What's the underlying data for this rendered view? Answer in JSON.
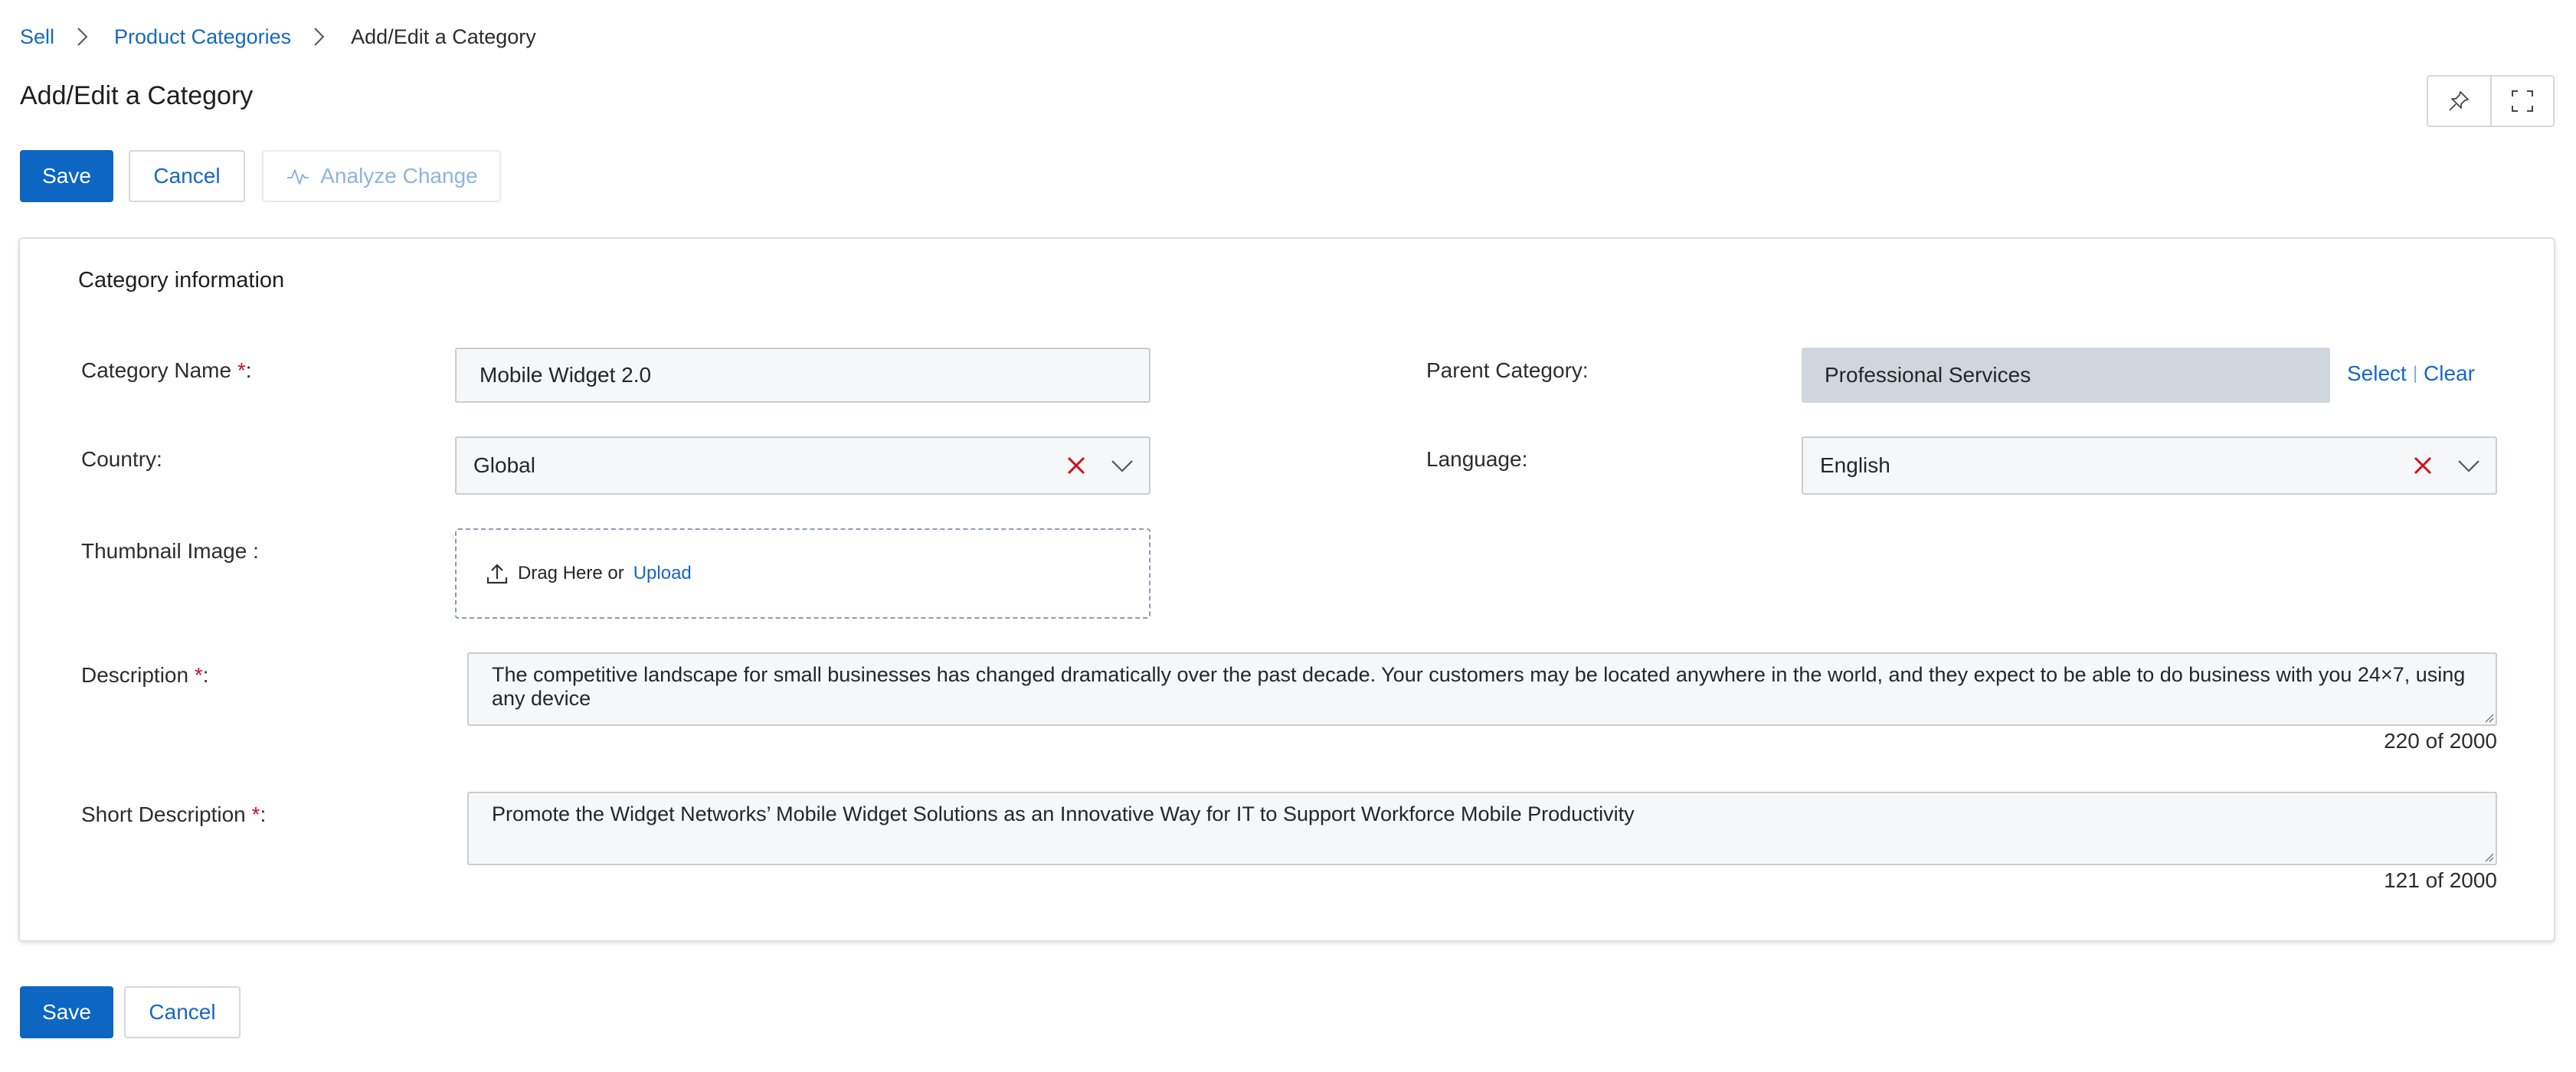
{
  "breadcrumb": {
    "items": [
      "Sell",
      "Product Categories"
    ],
    "current": "Add/Edit a Category"
  },
  "page": {
    "title": "Add/Edit a Category"
  },
  "toolbar": {
    "save_label": "Save",
    "cancel_label": "Cancel",
    "analyze_label": "Analyze Change",
    "pin_icon": "pin-icon",
    "expand_icon": "fullscreen-icon"
  },
  "section": {
    "title": "Category information"
  },
  "fields": {
    "category_name": {
      "label": "Category Name",
      "required": "*",
      "suffix": ":",
      "value": "Mobile Widget 2.0"
    },
    "parent_category": {
      "label": "Parent Category:",
      "value": "Professional Services",
      "select_label": "Select",
      "separator": "|",
      "clear_label": "Clear"
    },
    "country": {
      "label": "Country:",
      "value": "Global"
    },
    "language": {
      "label": "Language:",
      "value": "English"
    },
    "thumbnail": {
      "label": "Thumbnail Image :",
      "drag_text": "Drag Here or",
      "upload_label": "Upload"
    },
    "description": {
      "label": "Description",
      "required": "*",
      "suffix": ":",
      "value": "The competitive landscape for small businesses has changed dramatically over the past decade. Your customers may be located anywhere in the world, and they expect to be able to do business with you 24×7, using any device",
      "counter": "220 of 2000"
    },
    "short_description": {
      "label": "Short Description",
      "required": "*",
      "suffix": ":",
      "value": "Promote the Widget Networks’ Mobile Widget Solutions as an Innovative Way for IT to Support Workforce Mobile Productivity",
      "counter": "121 of 2000"
    }
  },
  "footer": {
    "save_label": "Save",
    "cancel_label": "Cancel"
  },
  "colors": {
    "primary": "#0d66c2",
    "link": "#1767c5",
    "required": "#c8102e",
    "clear_icon": "#d0101b",
    "readonly_bg": "#cfd6de"
  }
}
